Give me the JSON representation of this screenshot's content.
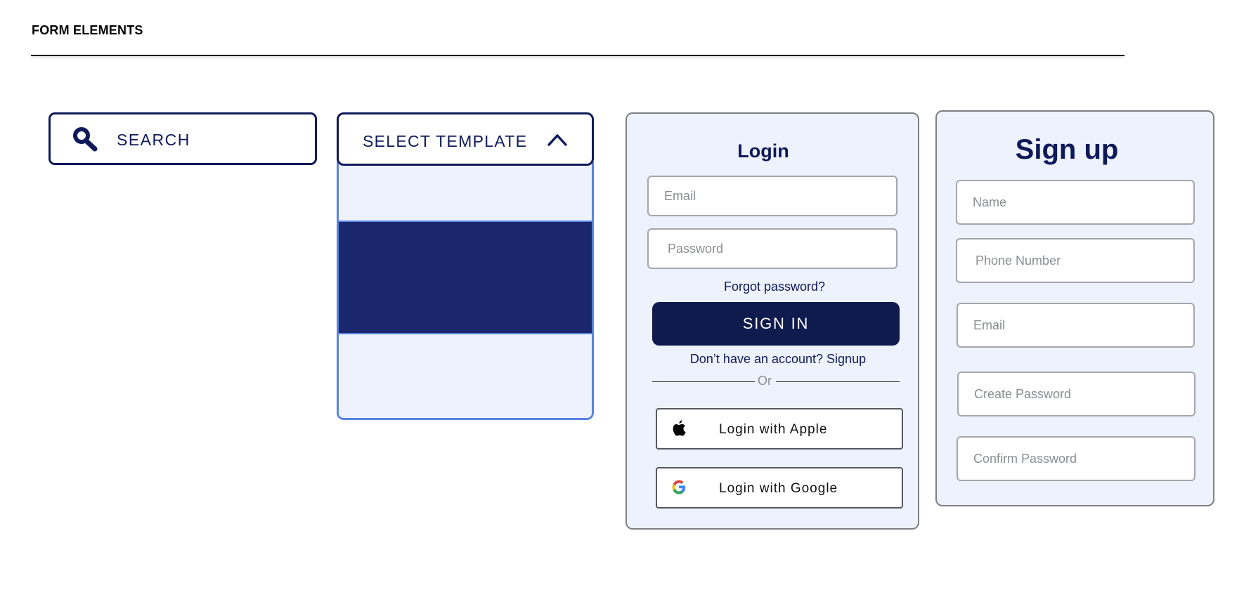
{
  "page": {
    "title": "FORM ELEMENTS"
  },
  "search": {
    "label": "SEARCH",
    "icon": "search-icon"
  },
  "select": {
    "label": "SELECT TEMPLATE",
    "icon": "chevron-up-icon",
    "options": [
      "",
      "",
      ""
    ]
  },
  "login": {
    "title": "Login",
    "email_placeholder": "Email",
    "password_placeholder": "Password",
    "forgot": "Forgot password?",
    "signin": "SIGN IN",
    "signup_prompt": "Don’t have an account? Signup",
    "or": "Or",
    "apple": "Login with Apple",
    "google": "Login with Google"
  },
  "signup": {
    "title": "Sign up",
    "name_placeholder": "Name",
    "phone_placeholder": "Phone Number",
    "email_placeholder": "Email",
    "create_password_placeholder": "Create Password",
    "confirm_password_placeholder": "Confirm Password"
  },
  "colors": {
    "primary": "#0f1a5a",
    "button": "#0f1a4d",
    "selected_option": "#1b276d",
    "card_background": "#edf2fc",
    "dropdown_border": "#5b83e0"
  }
}
